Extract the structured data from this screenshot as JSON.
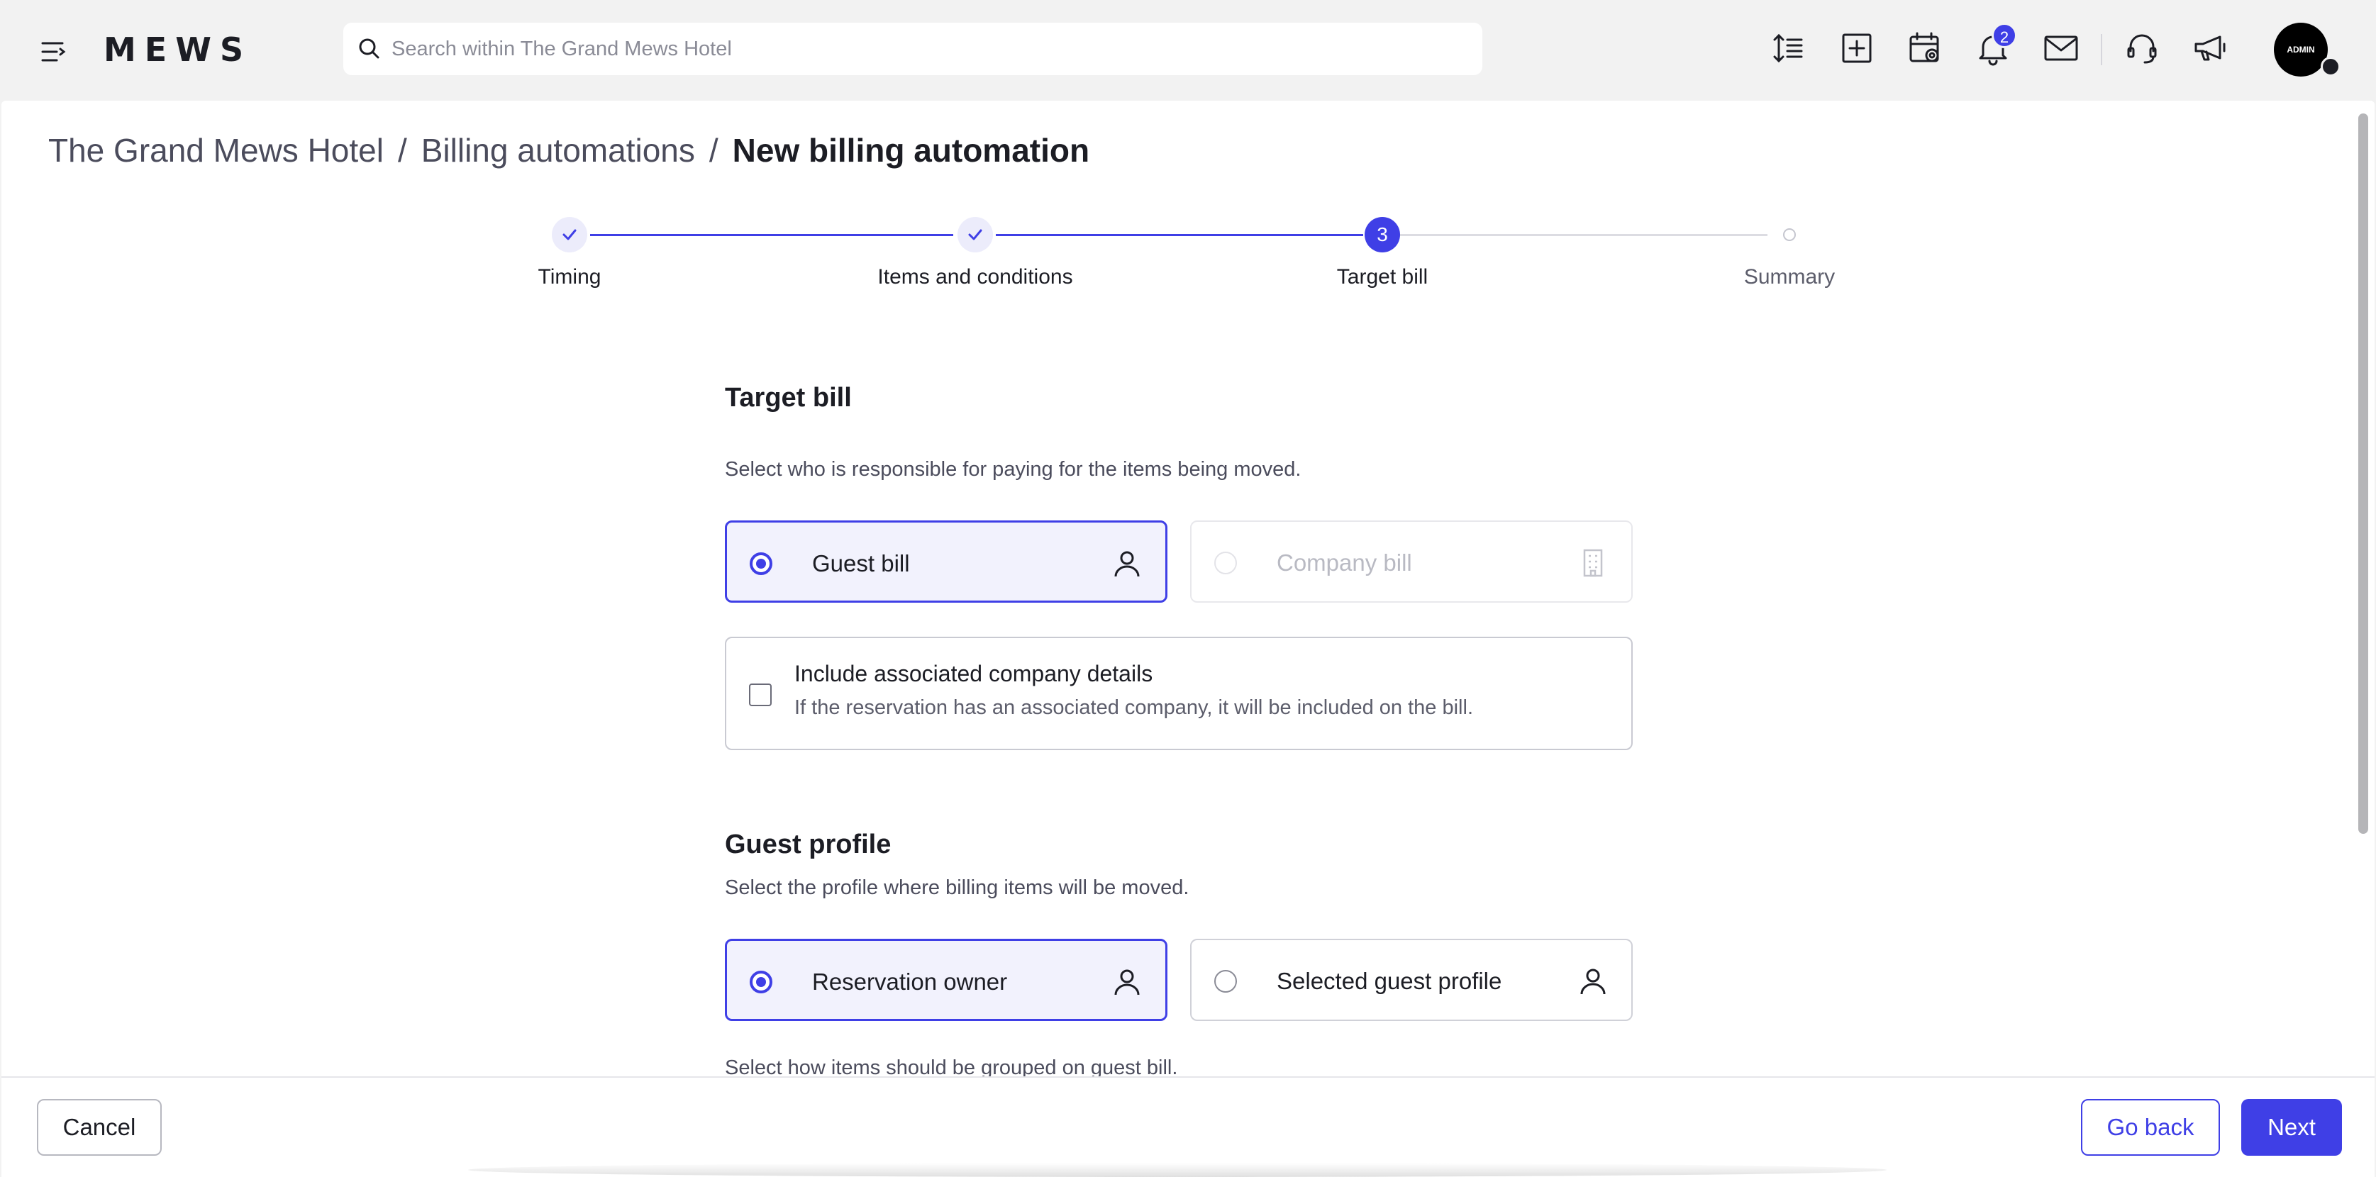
{
  "header": {
    "logo": "MEWS",
    "search_placeholder": "Search within The Grand Mews Hotel",
    "notification_count": "2",
    "avatar_label": "ADMIN"
  },
  "breadcrumb": {
    "items": [
      "The Grand Mews Hotel",
      "Billing automations"
    ],
    "separator": "/",
    "current": "New billing automation"
  },
  "stepper": {
    "steps": [
      {
        "label": "Timing",
        "state": "completed"
      },
      {
        "label": "Items and conditions",
        "state": "completed"
      },
      {
        "label": "Target bill",
        "state": "current",
        "number": "3"
      },
      {
        "label": "Summary",
        "state": "upcoming"
      }
    ]
  },
  "target_bill": {
    "title": "Target bill",
    "description": "Select who is responsible for paying for the items being moved.",
    "options": [
      {
        "label": "Guest bill",
        "state": "selected",
        "icon": "person-icon"
      },
      {
        "label": "Company bill",
        "state": "disabled",
        "icon": "building-icon"
      }
    ],
    "include_company": {
      "title": "Include associated company details",
      "description": "If the reservation has an associated company, it will be included on the bill.",
      "checked": false
    }
  },
  "guest_profile": {
    "title": "Guest profile",
    "description": "Select the profile where billing items will be moved.",
    "options": [
      {
        "label": "Reservation owner",
        "state": "selected",
        "icon": "person-icon"
      },
      {
        "label": "Selected guest profile",
        "state": "unselected",
        "icon": "person-icon"
      }
    ],
    "grouping_description": "Select how items should be grouped on guest bill."
  },
  "footer": {
    "cancel_label": "Cancel",
    "back_label": "Go back",
    "next_label": "Next"
  },
  "colors": {
    "accent": "#3f3fe6",
    "text": "#1c1d24",
    "muted": "#4b4c5c",
    "background": "#f2f2f2"
  }
}
